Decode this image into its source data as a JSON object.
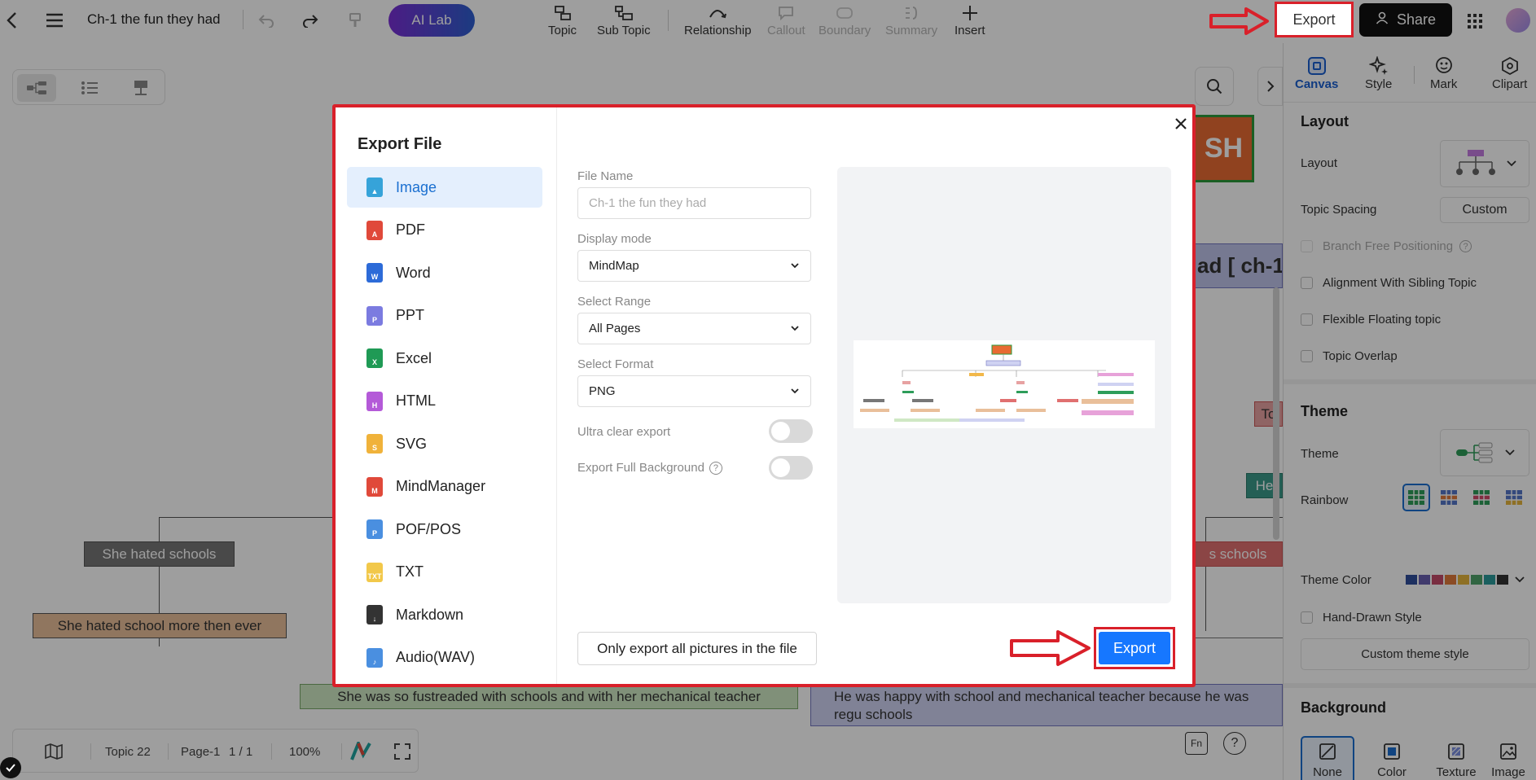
{
  "topbar": {
    "doc_title": "Ch-1 the fun they had",
    "ai_lab": "AI Lab",
    "tools": [
      {
        "label": "Topic",
        "icon": "topic-icon"
      },
      {
        "label": "Sub Topic",
        "icon": "subtopic-icon"
      },
      {
        "label": "Relationship",
        "icon": "relationship-icon"
      },
      {
        "label": "Callout",
        "icon": "callout-icon"
      },
      {
        "label": "Boundary",
        "icon": "boundary-icon"
      },
      {
        "label": "Summary",
        "icon": "summary-icon"
      },
      {
        "label": "Insert",
        "icon": "plus-icon"
      }
    ],
    "export_label": "Export",
    "share_label": "Share"
  },
  "canvas": {
    "nodes": {
      "she_hated_schools": "She hated schools",
      "she_hated_more": "She hated school more then ever",
      "frustrated": "She was so fustreaded with schools and with her mechanical teacher",
      "happy": "He was happy with school and mechanical teacher because he was regu schools",
      "partial_sh": "SH",
      "partial_title": "ad [ ch-1",
      "partial_to": "To",
      "partial_he": "He",
      "partial_schools": "s schools"
    }
  },
  "bottombar": {
    "topic_count": "Topic 22",
    "page": "Page-1",
    "page_count": "1 / 1",
    "zoom": "100%"
  },
  "right_panel": {
    "tabs": [
      {
        "label": "Canvas",
        "icon": "canvas-icon"
      },
      {
        "label": "Style",
        "icon": "style-icon"
      },
      {
        "label": "Mark",
        "icon": "mark-icon"
      },
      {
        "label": "Clipart",
        "icon": "clipart-icon"
      }
    ],
    "layout_section": "Layout",
    "layout_label": "Layout",
    "topic_spacing_label": "Topic Spacing",
    "topic_spacing_value": "Custom",
    "branch_free": "Branch Free Positioning",
    "alignment": "Alignment With Sibling Topic",
    "flexible": "Flexible Floating topic",
    "overlap": "Topic Overlap",
    "theme_section": "Theme",
    "theme_label": "Theme",
    "rainbow_label": "Rainbow",
    "theme_color_label": "Theme Color",
    "hand_drawn": "Hand-Drawn Style",
    "custom_theme": "Custom theme style",
    "background_section": "Background",
    "bg_options": [
      "None",
      "Color",
      "Texture",
      "Image"
    ],
    "theme_colors": [
      "#2f4e9b",
      "#6a5fb0",
      "#c44b6a",
      "#e07a3b",
      "#e6b53c",
      "#4fa36b",
      "#2b9a9a",
      "#333333"
    ]
  },
  "dialog": {
    "title": "Export File",
    "formats": [
      {
        "label": "Image",
        "color": "#36a3d9",
        "glyph": "▲"
      },
      {
        "label": "PDF",
        "color": "#e0493a",
        "glyph": "A"
      },
      {
        "label": "Word",
        "color": "#2d6bd8",
        "glyph": "W"
      },
      {
        "label": "PPT",
        "color": "#7b7be0",
        "glyph": "P"
      },
      {
        "label": "Excel",
        "color": "#1f9a55",
        "glyph": "X"
      },
      {
        "label": "HTML",
        "color": "#b45ad8",
        "glyph": "H"
      },
      {
        "label": "SVG",
        "color": "#f0b23a",
        "glyph": "S"
      },
      {
        "label": "MindManager",
        "color": "#e0493a",
        "glyph": "M"
      },
      {
        "label": "POF/POS",
        "color": "#4a8fe0",
        "glyph": "P"
      },
      {
        "label": "TXT",
        "color": "#f2c84a",
        "glyph": "TXT"
      },
      {
        "label": "Markdown",
        "color": "#333333",
        "glyph": "↓"
      },
      {
        "label": "Audio(WAV)",
        "color": "#4a8fe0",
        "glyph": "♪"
      }
    ],
    "file_name_label": "File Name",
    "file_name_placeholder": "Ch-1 the fun they had",
    "display_mode_label": "Display mode",
    "display_mode_value": "MindMap",
    "select_range_label": "Select Range",
    "select_range_value": "All Pages",
    "select_format_label": "Select Format",
    "select_format_value": "PNG",
    "ultra_clear_label": "Ultra clear export",
    "full_bg_label": "Export Full Background",
    "only_pictures_label": "Only export all pictures in the file",
    "export_label": "Export"
  },
  "annotations": {
    "highlight_color": "#d9202a"
  }
}
